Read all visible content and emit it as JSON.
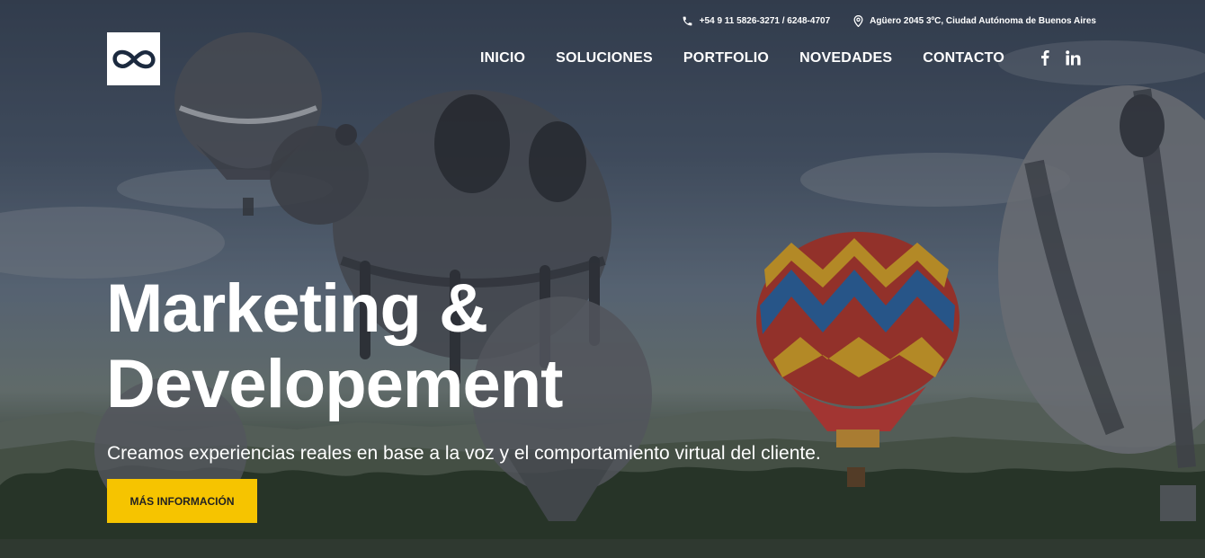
{
  "topbar": {
    "phone": "+54 9 11 5826-3271 / 6248-4707",
    "address": "Agüero 2045 3ºC, Ciudad Autónoma de Buenos Aires",
    "phone_icon": "phone-icon",
    "address_icon": "location-pin-icon"
  },
  "logo": {
    "icon": "infinity-logo-icon"
  },
  "nav": {
    "items": [
      {
        "label": "INICIO"
      },
      {
        "label": "SOLUCIONES"
      },
      {
        "label": "PORTFOLIO"
      },
      {
        "label": "NOVEDADES"
      },
      {
        "label": "CONTACTO"
      }
    ]
  },
  "social": {
    "items": [
      "facebook-icon",
      "linkedin-icon"
    ]
  },
  "hero": {
    "title_line1": "Marketing &",
    "title_line2": "Developement",
    "subtitle": "Creamos experiencias reales en base a la voz y el comportamiento virtual del cliente.",
    "cta_label": "MÁS INFORMACIÓN"
  },
  "colors": {
    "accent": "#f6c400",
    "text": "#ffffff",
    "logo_bg": "#ffffff"
  }
}
